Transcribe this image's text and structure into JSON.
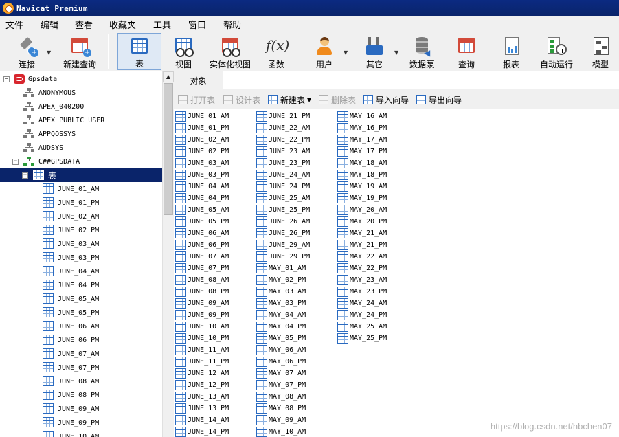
{
  "window": {
    "title": "Navicat Premium"
  },
  "menu": [
    "文件",
    "编辑",
    "查看",
    "收藏夹",
    "工具",
    "窗口",
    "帮助"
  ],
  "toolbar": [
    {
      "label": "连接",
      "icon": "connection-icon",
      "dropdown": true
    },
    {
      "label": "新建查询",
      "icon": "new-query-icon",
      "dropdown": false
    },
    {
      "label": "表",
      "icon": "table-icon",
      "active": true
    },
    {
      "label": "视图",
      "icon": "view-icon"
    },
    {
      "label": "实体化视图",
      "icon": "materialized-view-icon"
    },
    {
      "label": "函数",
      "icon": "function-icon"
    },
    {
      "label": "用户",
      "icon": "user-icon",
      "dropdown": true
    },
    {
      "label": "其它",
      "icon": "tools-icon",
      "dropdown": true
    },
    {
      "label": "数据泵",
      "icon": "data-pump-icon"
    },
    {
      "label": "查询",
      "icon": "query-icon"
    },
    {
      "label": "报表",
      "icon": "report-icon"
    },
    {
      "label": "自动运行",
      "icon": "automation-icon"
    },
    {
      "label": "模型",
      "icon": "model-icon"
    }
  ],
  "tree": {
    "connection": "Gpsdata",
    "schemas": [
      "ANONYMOUS",
      "APEX_040200",
      "APEX_PUBLIC_USER",
      "APPQOSSYS",
      "AUDSYS",
      "C##GPSDATA"
    ],
    "selected_node": "表",
    "tables": [
      "JUNE_01_AM",
      "JUNE_01_PM",
      "JUNE_02_AM",
      "JUNE_02_PM",
      "JUNE_03_AM",
      "JUNE_03_PM",
      "JUNE_04_AM",
      "JUNE_04_PM",
      "JUNE_05_AM",
      "JUNE_05_PM",
      "JUNE_06_AM",
      "JUNE_06_PM",
      "JUNE_07_AM",
      "JUNE_07_PM",
      "JUNE_08_AM",
      "JUNE_08_PM",
      "JUNE_09_AM",
      "JUNE_09_PM",
      "JUNE_10_AM"
    ]
  },
  "object_tab": "对象",
  "object_toolbar": {
    "open": "打开表",
    "design": "设计表",
    "new": "新建表",
    "delete": "删除表",
    "import": "导入向导",
    "export": "导出向导"
  },
  "objects": {
    "col1": [
      "JUNE_01_AM",
      "JUNE_01_PM",
      "JUNE_02_AM",
      "JUNE_02_PM",
      "JUNE_03_AM",
      "JUNE_03_PM",
      "JUNE_04_AM",
      "JUNE_04_PM",
      "JUNE_05_AM",
      "JUNE_05_PM",
      "JUNE_06_AM",
      "JUNE_06_PM",
      "JUNE_07_AM",
      "JUNE_07_PM",
      "JUNE_08_AM",
      "JUNE_08_PM",
      "JUNE_09_AM",
      "JUNE_09_PM",
      "JUNE_10_AM",
      "JUNE_10_PM",
      "JUNE_11_AM",
      "JUNE_11_PM",
      "JUNE_12_AM",
      "JUNE_12_PM",
      "JUNE_13_AM",
      "JUNE_13_PM",
      "JUNE_14_AM",
      "JUNE_14_PM"
    ],
    "col2": [
      "JUNE_21_PM",
      "JUNE_22_AM",
      "JUNE_22_PM",
      "JUNE_23_AM",
      "JUNE_23_PM",
      "JUNE_24_AM",
      "JUNE_24_PM",
      "JUNE_25_AM",
      "JUNE_25_PM",
      "JUNE_26_AM",
      "JUNE_26_PM",
      "JUNE_29_AM",
      "JUNE_29_PM",
      "MAY_01_AM",
      "MAY_02_PM",
      "MAY_03_AM",
      "MAY_03_PM",
      "MAY_04_AM",
      "MAY_04_PM",
      "MAY_05_PM",
      "MAY_06_AM",
      "MAY_06_PM",
      "MAY_07_AM",
      "MAY_07_PM",
      "MAY_08_AM",
      "MAY_08_PM",
      "MAY_09_AM",
      "MAY_10_AM"
    ],
    "col3": [
      "MAY_16_AM",
      "MAY_16_PM",
      "MAY_17_AM",
      "MAY_17_PM",
      "MAY_18_AM",
      "MAY_18_PM",
      "MAY_19_AM",
      "MAY_19_PM",
      "MAY_20_AM",
      "MAY_20_PM",
      "MAY_21_AM",
      "MAY_21_PM",
      "MAY_22_AM",
      "MAY_22_PM",
      "MAY_23_AM",
      "MAY_23_PM",
      "MAY_24_AM",
      "MAY_24_PM",
      "MAY_25_AM",
      "MAY_25_PM"
    ]
  },
  "watermark": "https://blog.csdn.net/hbchen07"
}
